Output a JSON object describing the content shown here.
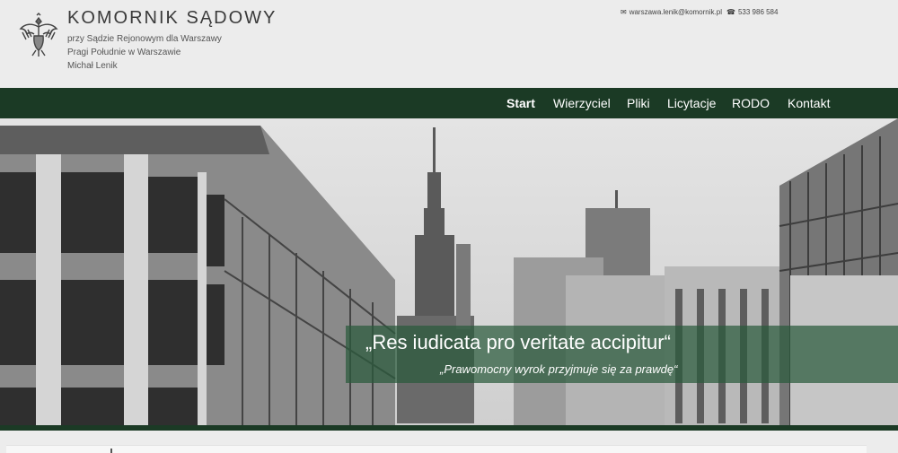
{
  "header": {
    "title": "KOMORNIK SĄDOWY",
    "subtitle_lines": [
      "przy Sądzie Rejonowym dla Warszawy",
      "Pragi Południe w Warszawie",
      "Michał Lenik"
    ],
    "contact": {
      "email": "warszawa.lenik@komornik.pl",
      "phone": "533 986 584",
      "email_icon": "envelope-icon",
      "phone_icon": "phone-icon"
    },
    "emblem_icon": "eagle-emblem-icon"
  },
  "nav": {
    "items": [
      {
        "label": "Start",
        "active": true
      },
      {
        "label": "Wierzyciel",
        "active": false
      },
      {
        "label": "Pliki",
        "active": false
      },
      {
        "label": "Licytacje",
        "active": false
      },
      {
        "label": "RODO",
        "active": false
      },
      {
        "label": "Kontakt",
        "active": false
      }
    ]
  },
  "hero": {
    "quote": "„Res iudicata pro veritate accipitur“",
    "translation": "„Prawomocny wyrok przyjmuje się za prawdę“"
  },
  "colors": {
    "nav_bg": "#1b3a25",
    "quote_band": "#2a5a3c",
    "header_bg": "#ececec"
  }
}
